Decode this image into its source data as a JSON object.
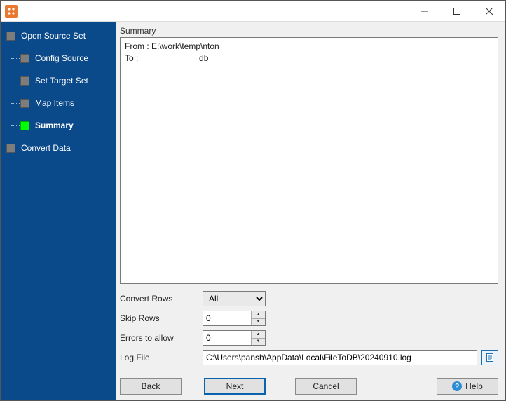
{
  "sidebar": {
    "items": [
      {
        "label": "Open Source Set"
      },
      {
        "label": "Config Source"
      },
      {
        "label": "Set Target Set"
      },
      {
        "label": "Map Items"
      },
      {
        "label": "Summary"
      },
      {
        "label": "Convert Data"
      }
    ]
  },
  "main": {
    "section_label": "Summary",
    "summary_text": "From : E:\\work\\temp\\nton\nTo :                          db",
    "controls": {
      "convert_rows_label": "Convert Rows",
      "convert_rows_value": "All",
      "skip_rows_label": "Skip Rows",
      "skip_rows_value": "0",
      "errors_label": "Errors to allow",
      "errors_value": "0",
      "log_file_label": "Log File",
      "log_file_value": "C:\\Users\\pansh\\AppData\\Local\\FileToDB\\20240910.log"
    },
    "buttons": {
      "back": "Back",
      "next": "Next",
      "cancel": "Cancel",
      "help": "Help"
    }
  }
}
